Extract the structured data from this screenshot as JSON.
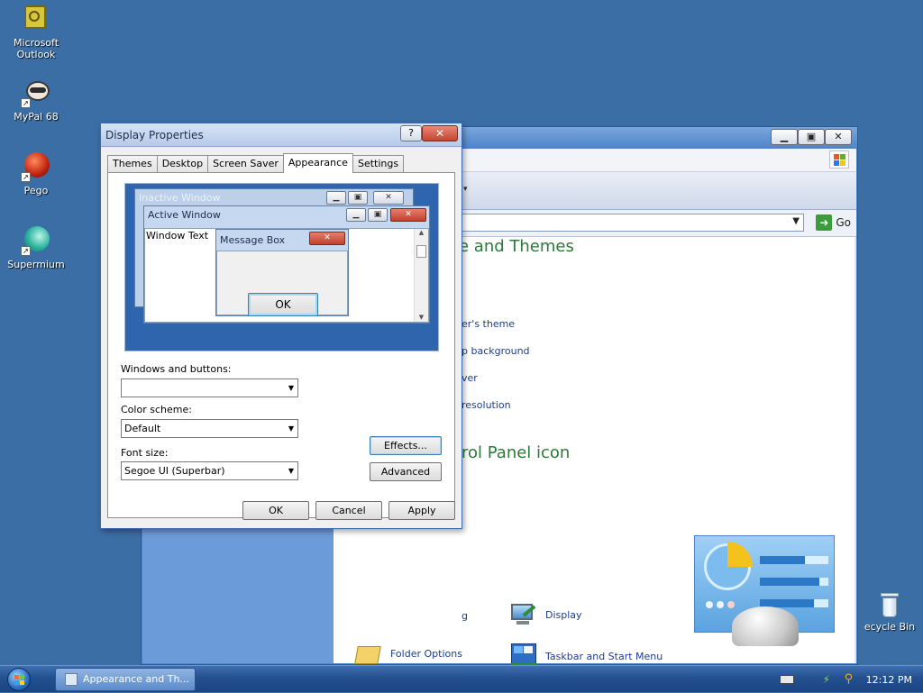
{
  "desktop": {
    "icons": [
      {
        "label": "Microsoft Outlook",
        "icon": "outlook-icon"
      },
      {
        "label": "MyPal 68",
        "icon": "raccoon-icon"
      },
      {
        "label": "Pego",
        "icon": "pego-icon"
      },
      {
        "label": "Supermium",
        "icon": "supermium-icon"
      }
    ],
    "recycle_bin": "ecycle Bin"
  },
  "explorer": {
    "go_label": "Go",
    "category_title": "e and Themes",
    "tasks": [
      "er's theme",
      "p background",
      "ver",
      "resolution"
    ],
    "panel_title": "rol Panel icon",
    "items": [
      {
        "label": "g"
      },
      {
        "label": "Display",
        "icon": "display-icon"
      },
      {
        "label": "Folder Options",
        "icon": "folder-options-icon"
      },
      {
        "label": "Taskbar and Start Menu",
        "icon": "taskbar-start-menu-icon"
      }
    ]
  },
  "dialog": {
    "title": "Display Properties",
    "help_label": "?",
    "close_label": "✕",
    "tabs": [
      "Themes",
      "Desktop",
      "Screen Saver",
      "Appearance",
      "Settings"
    ],
    "active_tab": "Appearance",
    "preview": {
      "inactive_title": "Inactive Window",
      "active_title": "Active Window",
      "window_text": "Window Text",
      "message_box_title": "Message Box",
      "ok_label": "OK"
    },
    "windows_buttons_label": "Windows and buttons:",
    "windows_buttons_value": "",
    "color_scheme_label": "Color scheme:",
    "color_scheme_value": "Default",
    "font_size_label": "Font size:",
    "font_size_value": "Segoe UI (Superbar)",
    "effects_label": "Effects...",
    "advanced_label": "Advanced",
    "ok_label": "OK",
    "cancel_label": "Cancel",
    "apply_label": "Apply"
  },
  "taskbar": {
    "task_button": "Appearance and Th...",
    "clock": "12:12 PM"
  },
  "colors": {
    "desktop": "#3a6ea5",
    "category_title": "#2b7a38",
    "link": "#1e3d90"
  }
}
